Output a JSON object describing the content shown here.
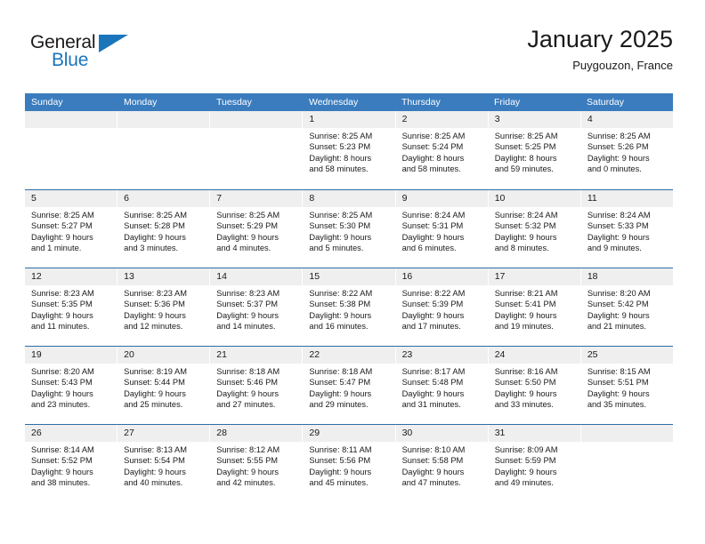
{
  "brand": {
    "name_part1": "General",
    "name_part2": "Blue",
    "flag_icon": "blue-triangle-flag"
  },
  "header": {
    "title": "January 2025",
    "location": "Puygouzon, France"
  },
  "calendar": {
    "weekday_headers": [
      "Sunday",
      "Monday",
      "Tuesday",
      "Wednesday",
      "Thursday",
      "Friday",
      "Saturday"
    ],
    "colors": {
      "header_bg": "#3a7cbe",
      "header_text": "#ffffff",
      "week_rule": "#2e6ca8",
      "daynum_bg": "#efefef",
      "brand_blue": "#1b75bb"
    },
    "labels": {
      "sunrise": "Sunrise:",
      "sunset": "Sunset:",
      "daylight": "Daylight:"
    },
    "weeks": [
      [
        {
          "day": "",
          "empty": true
        },
        {
          "day": "",
          "empty": true
        },
        {
          "day": "",
          "empty": true
        },
        {
          "day": "1",
          "sunrise": "Sunrise: 8:25 AM",
          "sunset": "Sunset: 5:23 PM",
          "daylight_line1": "Daylight: 8 hours",
          "daylight_line2": "and 58 minutes."
        },
        {
          "day": "2",
          "sunrise": "Sunrise: 8:25 AM",
          "sunset": "Sunset: 5:24 PM",
          "daylight_line1": "Daylight: 8 hours",
          "daylight_line2": "and 58 minutes."
        },
        {
          "day": "3",
          "sunrise": "Sunrise: 8:25 AM",
          "sunset": "Sunset: 5:25 PM",
          "daylight_line1": "Daylight: 8 hours",
          "daylight_line2": "and 59 minutes."
        },
        {
          "day": "4",
          "sunrise": "Sunrise: 8:25 AM",
          "sunset": "Sunset: 5:26 PM",
          "daylight_line1": "Daylight: 9 hours",
          "daylight_line2": "and 0 minutes."
        }
      ],
      [
        {
          "day": "5",
          "sunrise": "Sunrise: 8:25 AM",
          "sunset": "Sunset: 5:27 PM",
          "daylight_line1": "Daylight: 9 hours",
          "daylight_line2": "and 1 minute."
        },
        {
          "day": "6",
          "sunrise": "Sunrise: 8:25 AM",
          "sunset": "Sunset: 5:28 PM",
          "daylight_line1": "Daylight: 9 hours",
          "daylight_line2": "and 3 minutes."
        },
        {
          "day": "7",
          "sunrise": "Sunrise: 8:25 AM",
          "sunset": "Sunset: 5:29 PM",
          "daylight_line1": "Daylight: 9 hours",
          "daylight_line2": "and 4 minutes."
        },
        {
          "day": "8",
          "sunrise": "Sunrise: 8:25 AM",
          "sunset": "Sunset: 5:30 PM",
          "daylight_line1": "Daylight: 9 hours",
          "daylight_line2": "and 5 minutes."
        },
        {
          "day": "9",
          "sunrise": "Sunrise: 8:24 AM",
          "sunset": "Sunset: 5:31 PM",
          "daylight_line1": "Daylight: 9 hours",
          "daylight_line2": "and 6 minutes."
        },
        {
          "day": "10",
          "sunrise": "Sunrise: 8:24 AM",
          "sunset": "Sunset: 5:32 PM",
          "daylight_line1": "Daylight: 9 hours",
          "daylight_line2": "and 8 minutes."
        },
        {
          "day": "11",
          "sunrise": "Sunrise: 8:24 AM",
          "sunset": "Sunset: 5:33 PM",
          "daylight_line1": "Daylight: 9 hours",
          "daylight_line2": "and 9 minutes."
        }
      ],
      [
        {
          "day": "12",
          "sunrise": "Sunrise: 8:23 AM",
          "sunset": "Sunset: 5:35 PM",
          "daylight_line1": "Daylight: 9 hours",
          "daylight_line2": "and 11 minutes."
        },
        {
          "day": "13",
          "sunrise": "Sunrise: 8:23 AM",
          "sunset": "Sunset: 5:36 PM",
          "daylight_line1": "Daylight: 9 hours",
          "daylight_line2": "and 12 minutes."
        },
        {
          "day": "14",
          "sunrise": "Sunrise: 8:23 AM",
          "sunset": "Sunset: 5:37 PM",
          "daylight_line1": "Daylight: 9 hours",
          "daylight_line2": "and 14 minutes."
        },
        {
          "day": "15",
          "sunrise": "Sunrise: 8:22 AM",
          "sunset": "Sunset: 5:38 PM",
          "daylight_line1": "Daylight: 9 hours",
          "daylight_line2": "and 16 minutes."
        },
        {
          "day": "16",
          "sunrise": "Sunrise: 8:22 AM",
          "sunset": "Sunset: 5:39 PM",
          "daylight_line1": "Daylight: 9 hours",
          "daylight_line2": "and 17 minutes."
        },
        {
          "day": "17",
          "sunrise": "Sunrise: 8:21 AM",
          "sunset": "Sunset: 5:41 PM",
          "daylight_line1": "Daylight: 9 hours",
          "daylight_line2": "and 19 minutes."
        },
        {
          "day": "18",
          "sunrise": "Sunrise: 8:20 AM",
          "sunset": "Sunset: 5:42 PM",
          "daylight_line1": "Daylight: 9 hours",
          "daylight_line2": "and 21 minutes."
        }
      ],
      [
        {
          "day": "19",
          "sunrise": "Sunrise: 8:20 AM",
          "sunset": "Sunset: 5:43 PM",
          "daylight_line1": "Daylight: 9 hours",
          "daylight_line2": "and 23 minutes."
        },
        {
          "day": "20",
          "sunrise": "Sunrise: 8:19 AM",
          "sunset": "Sunset: 5:44 PM",
          "daylight_line1": "Daylight: 9 hours",
          "daylight_line2": "and 25 minutes."
        },
        {
          "day": "21",
          "sunrise": "Sunrise: 8:18 AM",
          "sunset": "Sunset: 5:46 PM",
          "daylight_line1": "Daylight: 9 hours",
          "daylight_line2": "and 27 minutes."
        },
        {
          "day": "22",
          "sunrise": "Sunrise: 8:18 AM",
          "sunset": "Sunset: 5:47 PM",
          "daylight_line1": "Daylight: 9 hours",
          "daylight_line2": "and 29 minutes."
        },
        {
          "day": "23",
          "sunrise": "Sunrise: 8:17 AM",
          "sunset": "Sunset: 5:48 PM",
          "daylight_line1": "Daylight: 9 hours",
          "daylight_line2": "and 31 minutes."
        },
        {
          "day": "24",
          "sunrise": "Sunrise: 8:16 AM",
          "sunset": "Sunset: 5:50 PM",
          "daylight_line1": "Daylight: 9 hours",
          "daylight_line2": "and 33 minutes."
        },
        {
          "day": "25",
          "sunrise": "Sunrise: 8:15 AM",
          "sunset": "Sunset: 5:51 PM",
          "daylight_line1": "Daylight: 9 hours",
          "daylight_line2": "and 35 minutes."
        }
      ],
      [
        {
          "day": "26",
          "sunrise": "Sunrise: 8:14 AM",
          "sunset": "Sunset: 5:52 PM",
          "daylight_line1": "Daylight: 9 hours",
          "daylight_line2": "and 38 minutes."
        },
        {
          "day": "27",
          "sunrise": "Sunrise: 8:13 AM",
          "sunset": "Sunset: 5:54 PM",
          "daylight_line1": "Daylight: 9 hours",
          "daylight_line2": "and 40 minutes."
        },
        {
          "day": "28",
          "sunrise": "Sunrise: 8:12 AM",
          "sunset": "Sunset: 5:55 PM",
          "daylight_line1": "Daylight: 9 hours",
          "daylight_line2": "and 42 minutes."
        },
        {
          "day": "29",
          "sunrise": "Sunrise: 8:11 AM",
          "sunset": "Sunset: 5:56 PM",
          "daylight_line1": "Daylight: 9 hours",
          "daylight_line2": "and 45 minutes."
        },
        {
          "day": "30",
          "sunrise": "Sunrise: 8:10 AM",
          "sunset": "Sunset: 5:58 PM",
          "daylight_line1": "Daylight: 9 hours",
          "daylight_line2": "and 47 minutes."
        },
        {
          "day": "31",
          "sunrise": "Sunrise: 8:09 AM",
          "sunset": "Sunset: 5:59 PM",
          "daylight_line1": "Daylight: 9 hours",
          "daylight_line2": "and 49 minutes."
        },
        {
          "day": "",
          "empty": true
        }
      ]
    ]
  }
}
